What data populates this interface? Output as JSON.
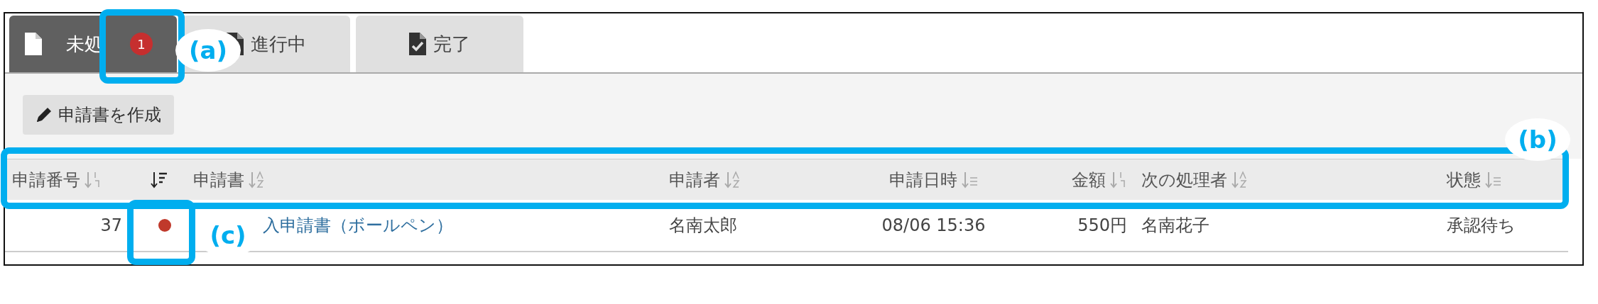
{
  "tabs": [
    {
      "label": "未処",
      "kind": "file",
      "selected": true,
      "badge": "1"
    },
    {
      "label": "進行中",
      "kind": "file",
      "selected": false
    },
    {
      "label": "完了",
      "kind": "file-check",
      "selected": false
    }
  ],
  "create_button": {
    "label": "申請書を作成"
  },
  "table": {
    "columns": [
      {
        "label": "申請番号",
        "kind": "numeric"
      },
      {
        "kind": "filter"
      },
      {
        "label": "申請書",
        "kind": "alpha"
      },
      {
        "label": "申請者",
        "kind": "alpha"
      },
      {
        "label": "申請日時",
        "kind": "list"
      },
      {
        "label": "金額",
        "kind": "numeric"
      },
      {
        "label": "次の処理者",
        "kind": "alpha"
      },
      {
        "label": "状態",
        "kind": "list"
      }
    ],
    "rows": [
      {
        "number": "37",
        "unread": true,
        "title": "入申請書（ボールペン）",
        "applicant": "名南太郎",
        "date": "08/06 15:36",
        "amount": "550円",
        "next": "名南花子",
        "status": "承認待ち"
      }
    ]
  },
  "callouts": [
    {
      "label": "(a)"
    },
    {
      "label": "(b)"
    },
    {
      "label": "(c)"
    }
  ]
}
